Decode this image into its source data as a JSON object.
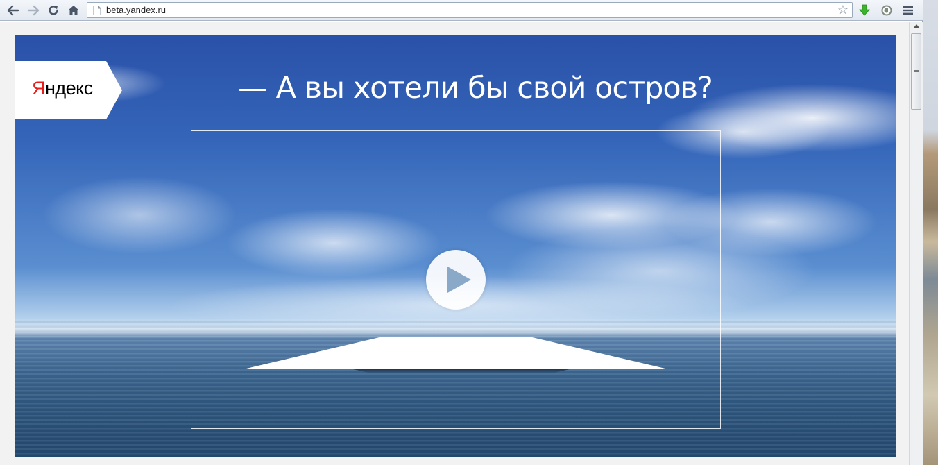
{
  "browser": {
    "url": "beta.yandex.ru"
  },
  "logo": {
    "first_letter": "Я",
    "rest": "ндекс"
  },
  "hero": {
    "headline": "— А вы хотели бы свой остров?"
  },
  "colors": {
    "brand_red": "#ea1b1b",
    "sky_top": "#2a51a8"
  }
}
